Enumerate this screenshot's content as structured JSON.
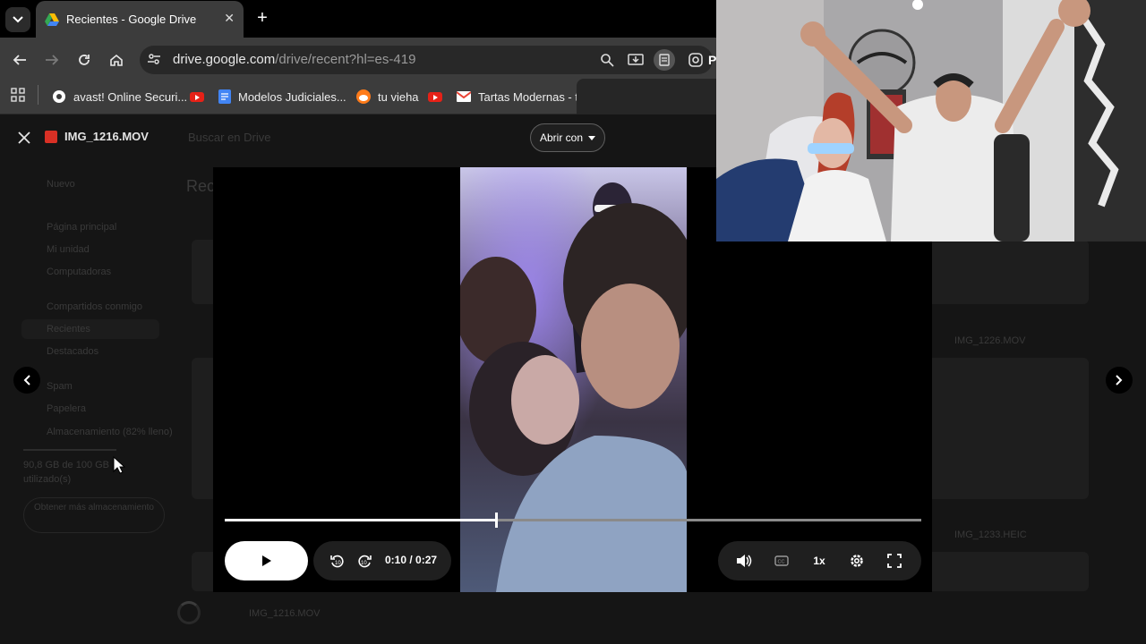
{
  "browser": {
    "tab_title": "Recientes - Google Drive",
    "url_host": "drive.google.com",
    "url_path": "/drive/recent?hl=es-419",
    "profile_letter": "P"
  },
  "bookmarks": [
    {
      "label": "avast! Online Securi...",
      "icon": "avast-icon"
    },
    {
      "label": "",
      "icon": "youtube-icon"
    },
    {
      "label": "Modelos Judiciales...",
      "icon": "doc-icon"
    },
    {
      "label": "tu vieha",
      "icon": "reddit-icon"
    },
    {
      "label": "",
      "icon": "youtube-icon"
    },
    {
      "label": "Tartas Modernas - t...",
      "icon": "gmail-icon"
    }
  ],
  "viewer": {
    "file_name": "IMG_1216.MOV",
    "open_with_label": "Abrir con",
    "time_current": "0:10",
    "time_total": "/ 0:27",
    "progress_fraction": 0.39,
    "speed_label": "1x"
  },
  "drive_background": {
    "search_placeholder": "Buscar en Drive",
    "heading": "Rec",
    "nav_items": [
      "Nuevo",
      "Página principal",
      "Mi unidad",
      "Computadoras",
      "Compartidos conmigo",
      "Recientes",
      "Destacados",
      "Spam",
      "Papelera",
      "Almacenamiento (82% lleno)"
    ],
    "storage_text": "90,8 GB de 100 GB",
    "storage_sub": "utilizado(s)",
    "storage_button": "Obtener más almacenamiento",
    "file_labels": [
      "IMG_1226.MOV",
      "IMG_1233.HEIC",
      "IMG_1216.MOV"
    ]
  },
  "colors": {
    "chrome_bg": "#3c3c3c",
    "accent_red": "#d93025"
  }
}
